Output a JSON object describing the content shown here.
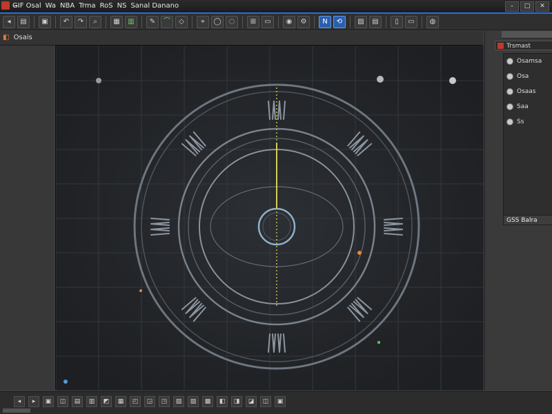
{
  "window": {
    "title_parts": [
      "G̶IF Osal",
      "Wa",
      "NBA",
      "Trma",
      "RoS",
      "NS",
      "Sanal Danano"
    ],
    "controls": [
      "–",
      "□",
      "✕"
    ]
  },
  "toolbar": {
    "buttons": [
      {
        "icon": "arrow-back-icon",
        "glyph": "◂"
      },
      {
        "icon": "file-icon",
        "glyph": "▤"
      },
      {
        "icon": "sep"
      },
      {
        "icon": "image-icon",
        "glyph": "▣"
      },
      {
        "icon": "sep"
      },
      {
        "icon": "undo-icon",
        "glyph": "↶"
      },
      {
        "icon": "redo-icon",
        "glyph": "↷"
      },
      {
        "icon": "zoom-icon",
        "glyph": "⌕"
      },
      {
        "icon": "sep"
      },
      {
        "icon": "grid-icon",
        "glyph": "▦"
      },
      {
        "icon": "layer-icon",
        "glyph": "▥",
        "green": true
      },
      {
        "icon": "sep"
      },
      {
        "icon": "pen-icon",
        "glyph": "✎"
      },
      {
        "icon": "brush-icon",
        "glyph": "⌒",
        "green": true
      },
      {
        "icon": "eraser-icon",
        "glyph": "◇"
      },
      {
        "icon": "sep"
      },
      {
        "icon": "snap-icon",
        "glyph": "⌖"
      },
      {
        "icon": "circle-icon",
        "glyph": "◯"
      },
      {
        "icon": "ellipse-icon",
        "glyph": "◌"
      },
      {
        "icon": "sep"
      },
      {
        "icon": "measure-icon",
        "glyph": "⊞"
      },
      {
        "icon": "layout-icon",
        "glyph": "▭"
      },
      {
        "icon": "sep"
      },
      {
        "icon": "node-icon",
        "glyph": "◉"
      },
      {
        "icon": "settings-icon",
        "glyph": "⚙"
      },
      {
        "icon": "sep"
      },
      {
        "icon": "select-icon",
        "glyph": "N",
        "active": true
      },
      {
        "icon": "transform-icon",
        "glyph": "⟲",
        "active": true
      },
      {
        "icon": "sep"
      },
      {
        "icon": "view-icon",
        "glyph": "▨"
      },
      {
        "icon": "render-icon",
        "glyph": "▤"
      },
      {
        "icon": "sep"
      },
      {
        "icon": "panel-icon",
        "glyph": "▯"
      },
      {
        "icon": "console-icon",
        "glyph": "▭"
      },
      {
        "icon": "sep"
      },
      {
        "icon": "options-icon",
        "glyph": "◍"
      }
    ]
  },
  "subbar": {
    "label": "Osais"
  },
  "right_panel": {
    "tab_label": "Trsmast",
    "rows": [
      "Osamsa",
      "Osa",
      "Osaas",
      "Saa",
      "Ss",
      "",
      "",
      "",
      ""
    ],
    "footer": "GSS Balra"
  },
  "statusbar": {
    "buttons": [
      "◂",
      "▸",
      "▣",
      "◫",
      "▤",
      "▥",
      "◩",
      "▦",
      "◰",
      "◲",
      "◳",
      "▧",
      "▨",
      "▩",
      "◧",
      "◨",
      "◪",
      "◫",
      "▣"
    ]
  }
}
